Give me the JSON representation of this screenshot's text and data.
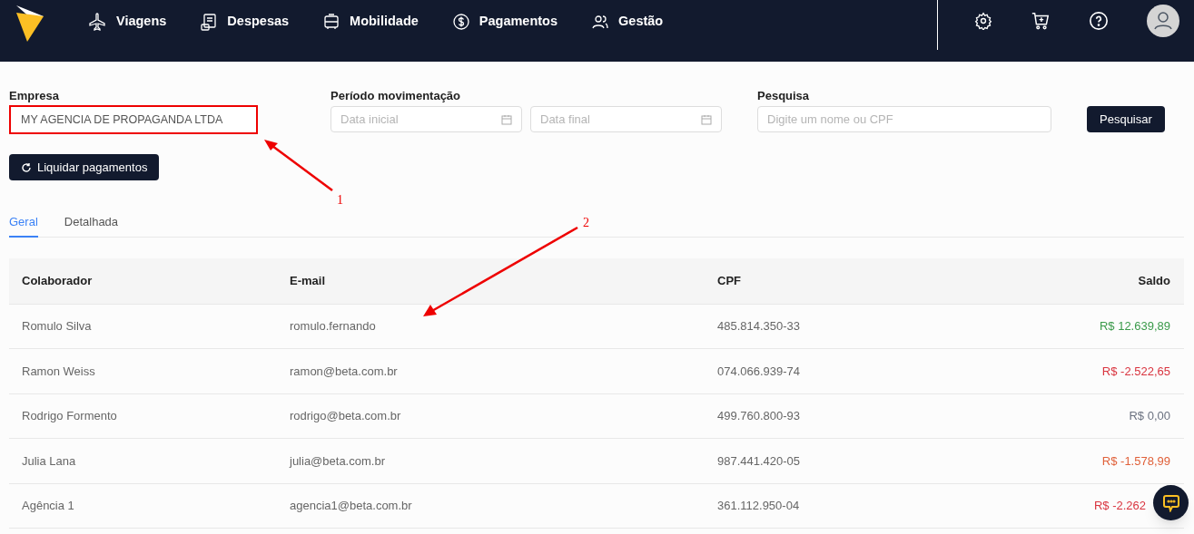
{
  "nav": {
    "items": [
      {
        "label": "Viagens"
      },
      {
        "label": "Despesas"
      },
      {
        "label": "Mobilidade"
      },
      {
        "label": "Pagamentos"
      },
      {
        "label": "Gestão"
      }
    ]
  },
  "filters": {
    "empresa": {
      "label": "Empresa",
      "value": "MY AGENCIA DE PROPAGANDA LTDA",
      "highlighted": true
    },
    "periodo": {
      "label": "Período movimentação",
      "start_placeholder": "Data inicial",
      "end_placeholder": "Data final"
    },
    "pesquisa": {
      "label": "Pesquisa",
      "placeholder": "Digite um nome ou CPF"
    },
    "search_button": "Pesquisar",
    "liquidar_button": "Liquidar pagamentos"
  },
  "tabs": [
    {
      "label": "Geral",
      "selected": true
    },
    {
      "label": "Detalhada",
      "selected": false
    }
  ],
  "table": {
    "columns": [
      "Colaborador",
      "E-mail",
      "CPF",
      "Saldo"
    ],
    "rows": [
      {
        "name": "Romulo Silva",
        "email": "romulo.fernando",
        "cpf": "485.814.350-33",
        "saldo": "R$ 12.639,89",
        "color": "#3a9a4a"
      },
      {
        "name": "Ramon Weiss",
        "email": "ramon@beta.com.br",
        "cpf": "074.066.939-74",
        "saldo": "R$ -2.522,65",
        "color": "#d9343f"
      },
      {
        "name": "Rodrigo Formento",
        "email": "rodrigo@beta.com.br",
        "cpf": "499.760.800-93",
        "saldo": "R$ 0,00",
        "color": "#6b7280"
      },
      {
        "name": "Julia Lana",
        "email": "julia@beta.com.br",
        "cpf": "987.441.420-05",
        "saldo": "R$ -1.578,99",
        "color": "#e0613a"
      },
      {
        "name": "Agência 1",
        "email": "agencia1@beta.com.br",
        "cpf": "361.112.950-04",
        "saldo": "R$ -2.262",
        "color": "#d9343f"
      }
    ]
  },
  "annotations": [
    {
      "label": "1"
    },
    {
      "label": "2"
    }
  ]
}
